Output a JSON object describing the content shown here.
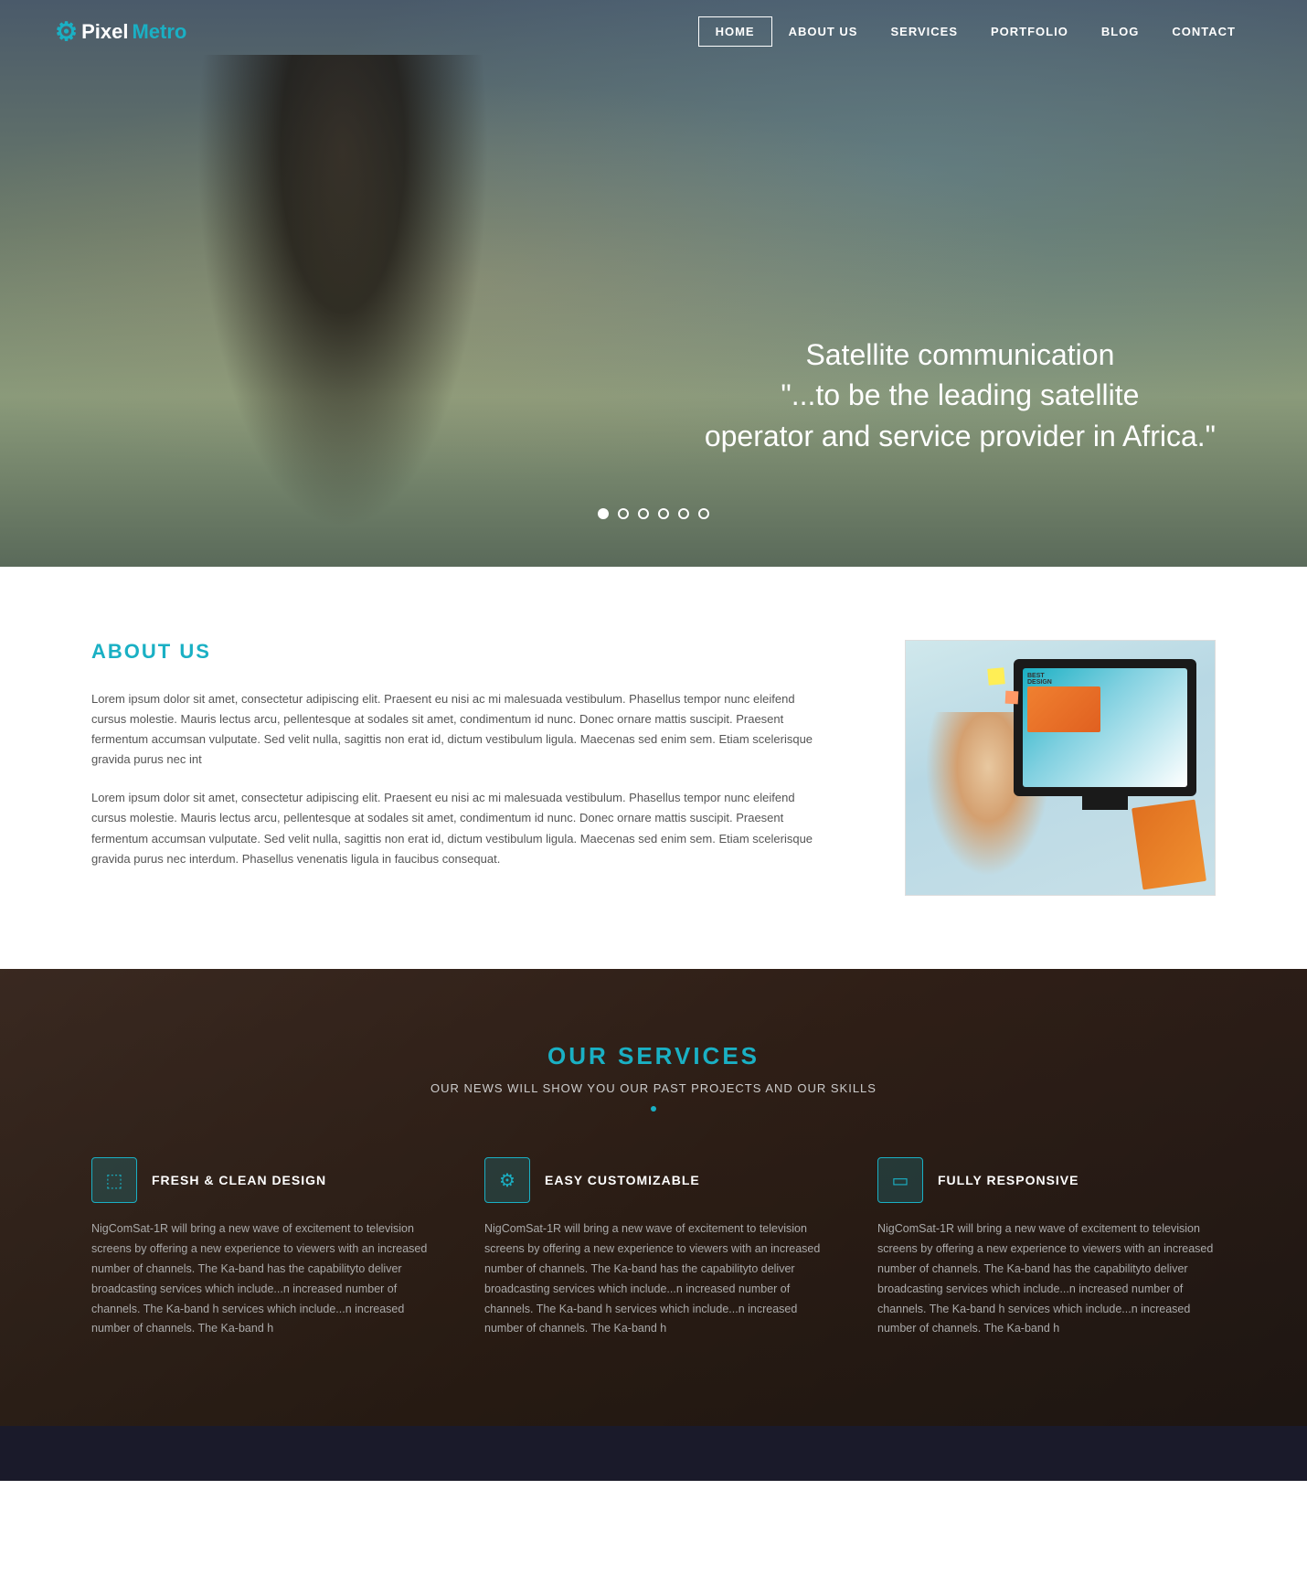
{
  "logo": {
    "icon": "⚙",
    "pixel": "Pixel",
    "metro": "Metro"
  },
  "nav": {
    "items": [
      {
        "label": "HOME",
        "active": true
      },
      {
        "label": "ABOUT US",
        "active": false
      },
      {
        "label": "SERVICES",
        "active": false
      },
      {
        "label": "PORTFOLIO",
        "active": false
      },
      {
        "label": "BLOG",
        "active": false
      },
      {
        "label": "CONTACT",
        "active": false
      }
    ]
  },
  "hero": {
    "line1": "Satellite communication",
    "line2": "\"...to be the leading satellite",
    "line3": "operator and service provider in Africa.\"",
    "dots": 6,
    "active_dot": 1
  },
  "about": {
    "title": "ABOUT US",
    "paragraph1": "Lorem ipsum dolor sit amet, consectetur adipiscing elit. Praesent eu nisi ac mi malesuada vestibulum. Phasellus tempor nunc eleifend cursus molestie. Mauris lectus arcu, pellentesque at sodales sit amet, condimentum id nunc. Donec ornare mattis suscipit. Praesent fermentum accumsan vulputate. Sed velit nulla, sagittis non erat id, dictum vestibulum ligula. Maecenas sed enim sem. Etiam scelerisque gravida purus nec int",
    "paragraph2": "Lorem ipsum dolor sit amet, consectetur adipiscing elit. Praesent eu nisi ac mi malesuada vestibulum. Phasellus tempor nunc eleifend cursus molestie. Mauris lectus arcu, pellentesque at sodales sit amet, condimentum id nunc. Donec ornare mattis suscipit. Praesent fermentum accumsan vulputate. Sed velit nulla, sagittis non erat id, dictum vestibulum ligula. Maecenas sed enim sem. Etiam scelerisque gravida purus nec interdum. Phasellus venenatis ligula in faucibus consequat.",
    "image_alt": "About Us Image"
  },
  "services": {
    "title": "OUR SERVICES",
    "subtitle": "OUR NEWS WILL SHOW YOU OUR PAST PROJECTS AND OUR SKILLS",
    "items": [
      {
        "icon": "▣",
        "name": "FRESH & CLEAN DESIGN",
        "description": "NigComSat-1R will bring a new wave of excitement to television screens by offering a new experience to viewers with an increased number of channels. The Ka-band has the capabilityto deliver broadcasting services which include...n increased number of channels. The Ka-band h services which include...n increased number of channels. The Ka-band h"
      },
      {
        "icon": "⚙",
        "name": "EASY CUSTOMIZABLE",
        "description": "NigComSat-1R will bring a new wave of excitement to television screens by offering a new experience to viewers with an increased number of channels. The Ka-band has the capabilityto deliver broadcasting services which include...n increased number of channels. The Ka-band h services which include...n increased number of channels. The Ka-band h"
      },
      {
        "icon": "▢",
        "name": "FULLY RESPONSIVE",
        "description": "NigComSat-1R will bring a new wave of excitement to television screens by offering a new experience to viewers with an increased number of channels. The Ka-band has the capabilityto deliver broadcasting services which include...n increased number of channels. The Ka-band h services which include...n increased number of channels. The Ka-band h"
      }
    ]
  }
}
